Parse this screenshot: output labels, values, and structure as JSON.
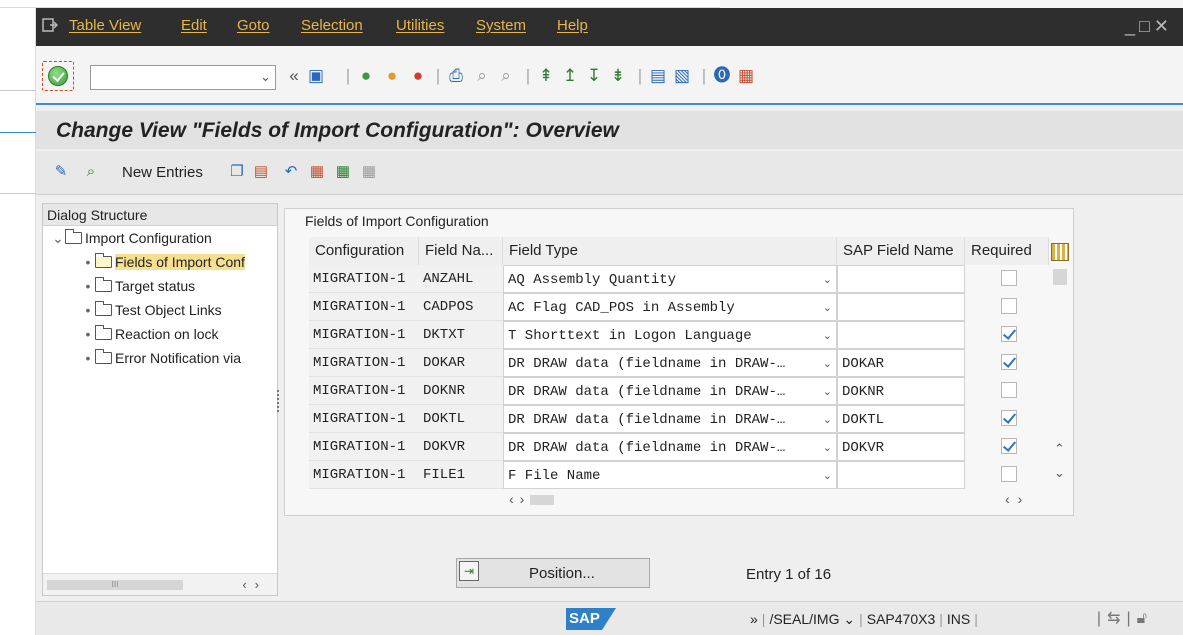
{
  "menubar": {
    "items": [
      "Table View",
      "Edit",
      "Goto",
      "Selection",
      "Utilities",
      "System",
      "Help"
    ]
  },
  "toolbar": {
    "command_field_value": ""
  },
  "page": {
    "title": "Change View \"Fields of Import Configuration\": Overview"
  },
  "app_toolbar": {
    "new_entries_label": "New Entries"
  },
  "dialog_structure": {
    "title": "Dialog Structure",
    "root": "Import Configuration",
    "children": [
      "Fields of Import Conf",
      "Target status",
      "Test Object Links",
      "Reaction on lock",
      "Error Notification via"
    ],
    "selected_index": 0
  },
  "table": {
    "caption": "Fields of Import Configuration",
    "columns": [
      "Configuration",
      "Field Na...",
      "Field Type",
      "SAP Field Name",
      "Required"
    ],
    "rows": [
      {
        "config": "MIGRATION-1",
        "field": "ANZAHL",
        "type": "AQ Assembly Quantity",
        "sap_field": "",
        "required": false
      },
      {
        "config": "MIGRATION-1",
        "field": "CADPOS",
        "type": "AC Flag CAD_POS in Assembly",
        "sap_field": "",
        "required": false
      },
      {
        "config": "MIGRATION-1",
        "field": "DKTXT",
        "type": "T Shorttext in Logon Language",
        "sap_field": "",
        "required": true
      },
      {
        "config": "MIGRATION-1",
        "field": "DOKAR",
        "type": "DR DRAW data (fieldname in DRAW-…",
        "sap_field": "DOKAR",
        "required": true
      },
      {
        "config": "MIGRATION-1",
        "field": "DOKNR",
        "type": "DR DRAW data (fieldname in DRAW-…",
        "sap_field": "DOKNR",
        "required": false
      },
      {
        "config": "MIGRATION-1",
        "field": "DOKTL",
        "type": "DR DRAW data (fieldname in DRAW-…",
        "sap_field": "DOKTL",
        "required": true
      },
      {
        "config": "MIGRATION-1",
        "field": "DOKVR",
        "type": "DR DRAW data (fieldname in DRAW-…",
        "sap_field": "DOKVR",
        "required": true
      },
      {
        "config": "MIGRATION-1",
        "field": "FILE1",
        "type": "F File Name",
        "sap_field": "",
        "required": false
      }
    ]
  },
  "footer": {
    "position_label": "Position...",
    "entry_info": "Entry 1 of 16"
  },
  "statusbar": {
    "logo": "SAP",
    "transaction": "/SEAL/IMG",
    "system": "SAP470X3",
    "mode": "INS"
  },
  "colors": {
    "menubar_bg": "#2e2e2e",
    "menu_text": "#e9b64a",
    "accent": "#3d8ad6",
    "selected_node": "#f6e08f",
    "checkbox_check": "#2d73c4"
  }
}
